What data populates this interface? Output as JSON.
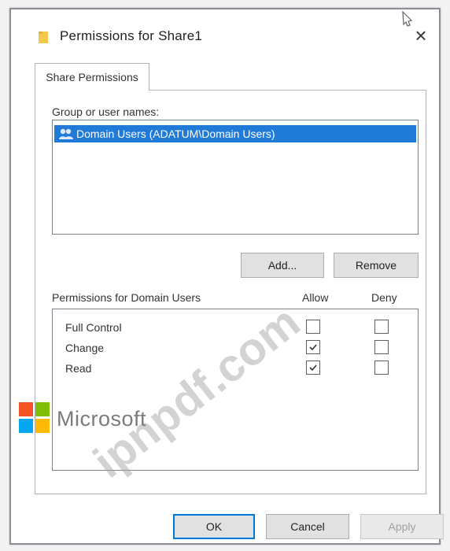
{
  "dialog": {
    "title": "Permissions for Share1"
  },
  "tabs": [
    {
      "label": "Share Permissions",
      "active": true
    }
  ],
  "users": {
    "label": "Group or user names:",
    "items": [
      {
        "label": "Domain Users (ADATUM\\Domain Users)",
        "selected": true
      }
    ]
  },
  "actions": {
    "add_label": "Add...",
    "remove_label": "Remove"
  },
  "permissions": {
    "header_label": "Permissions for Domain Users",
    "allow_label": "Allow",
    "deny_label": "Deny",
    "rows": [
      {
        "label": "Full Control",
        "allow": false,
        "deny": false
      },
      {
        "label": "Change",
        "allow": true,
        "deny": false
      },
      {
        "label": "Read",
        "allow": true,
        "deny": false
      }
    ]
  },
  "footer": {
    "ok_label": "OK",
    "cancel_label": "Cancel",
    "apply_label": "Apply"
  },
  "overlay": {
    "watermark_text": "ipnpdf.com",
    "brand_text": "Microsoft"
  },
  "colors": {
    "selection": "#1f7ad8",
    "text": "#333333",
    "ok_border": "#0078d7",
    "watermark": "#a8a8a8",
    "brand_text": "#7b7b7b"
  },
  "icons": {
    "title": "folder-icon",
    "close": "close-icon",
    "cursor": "cursor-icon",
    "user": "user-group-icon",
    "checkbox": "checkbox-icon",
    "logo": "microsoft-logo"
  }
}
